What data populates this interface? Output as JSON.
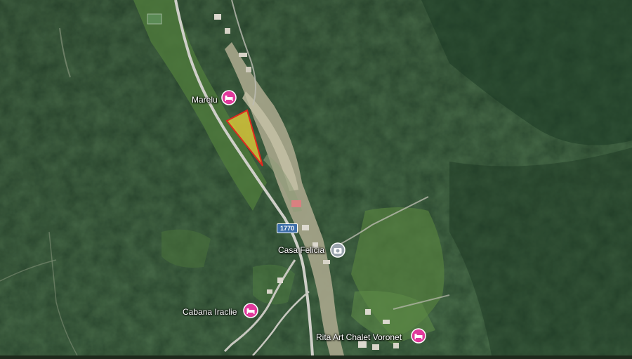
{
  "map": {
    "view": "satellite",
    "parcel": {
      "fill": "#d6c63a",
      "stroke": "#e0281f"
    },
    "road": {
      "shield": "1770"
    },
    "places": [
      {
        "name": "Marelu",
        "icon": "lodging-icon",
        "color": "#e0399b"
      },
      {
        "name": "Casa Felicia",
        "icon": "camera-icon",
        "color": "#9aa4ad"
      },
      {
        "name": "Cabana Iraclie",
        "icon": "lodging-icon",
        "color": "#e0399b"
      },
      {
        "name": "Rita Art Chalet Voronet",
        "icon": "lodging-icon",
        "color": "#e0399b"
      }
    ]
  }
}
